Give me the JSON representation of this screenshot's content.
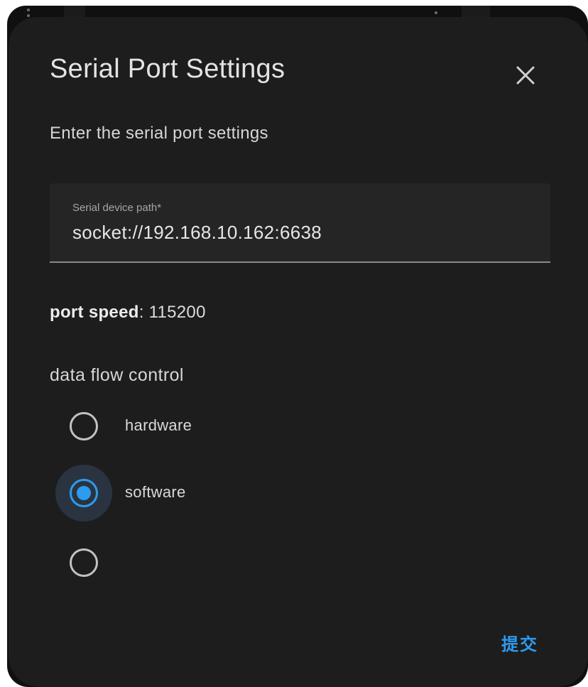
{
  "dialog": {
    "title": "Serial Port Settings",
    "subtitle": "Enter the serial port settings",
    "close_icon": "close-icon"
  },
  "device_path_field": {
    "label": "Serial device path*",
    "value": "socket://192.168.10.162:6638"
  },
  "port_speed": {
    "label": "port speed",
    "separator": ":",
    "value": "115200"
  },
  "flow_control": {
    "label": "data flow control",
    "options": [
      {
        "label": "hardware",
        "checked": false
      },
      {
        "label": "software",
        "checked": true
      },
      {
        "label": "",
        "checked": false
      }
    ]
  },
  "actions": {
    "submit_label": "提交"
  },
  "colors": {
    "dialog_bg": "#1d1d1d",
    "accent": "#2d9bf0",
    "text_primary": "#e3e3e3",
    "field_bg": "#252525"
  }
}
